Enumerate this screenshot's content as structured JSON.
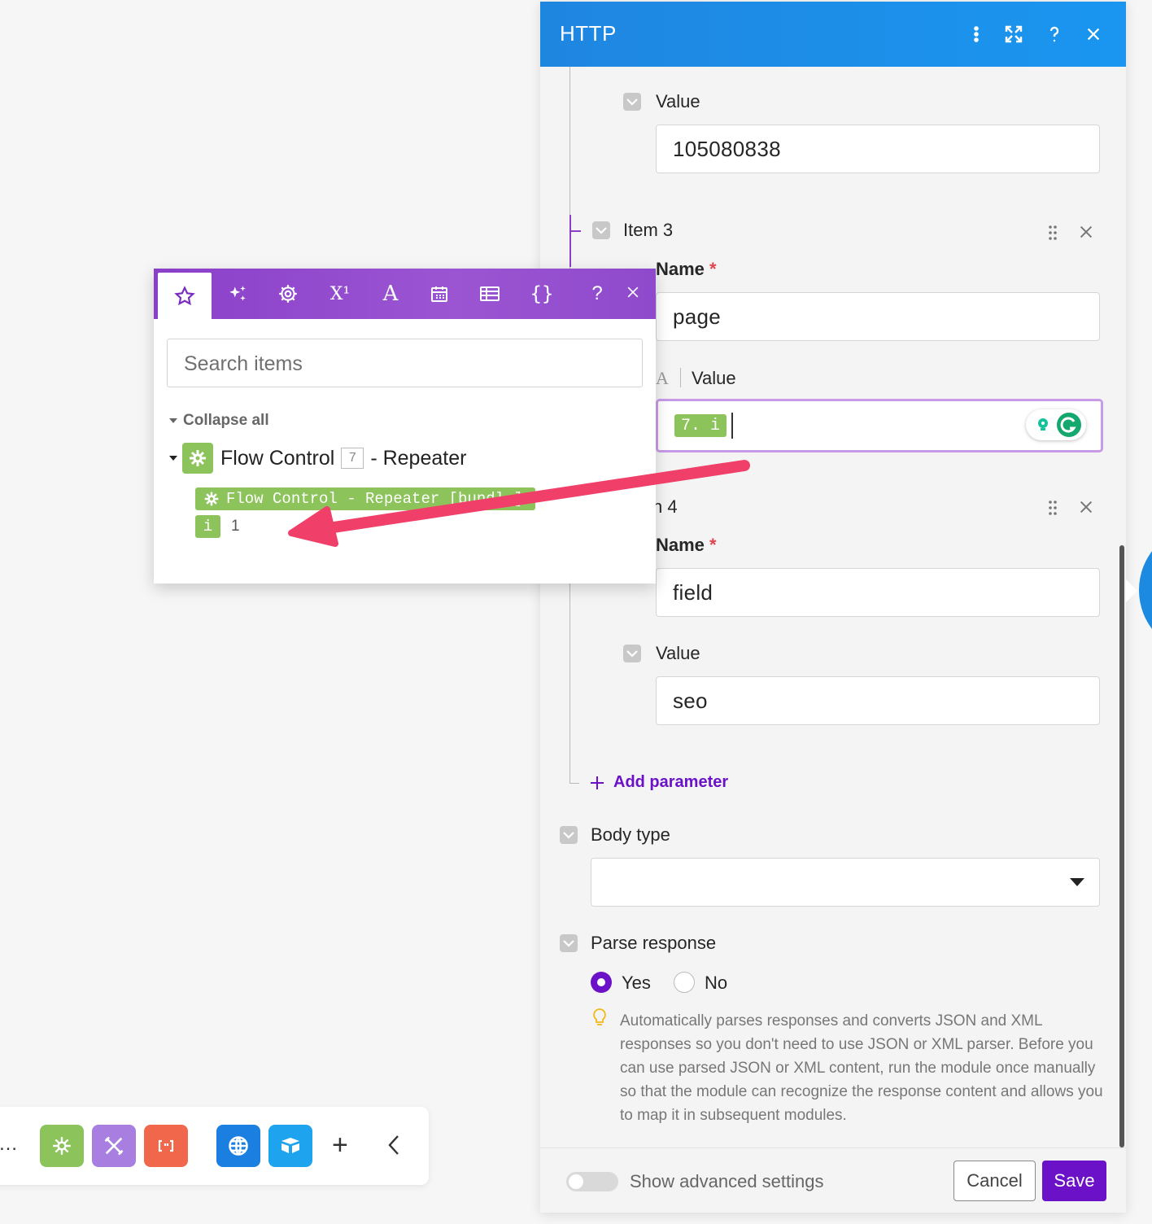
{
  "http_panel": {
    "title": "HTTP",
    "item2_value": {
      "label": "Value",
      "value": "105080838"
    },
    "item3": {
      "label": "Item 3",
      "name_label": "Name",
      "required_mark": "*",
      "name_value": "page",
      "value_prefix": "A",
      "value_label": "Value",
      "value_chip": "7. i"
    },
    "item4": {
      "label": "n 4",
      "name_label": "Name",
      "required_mark": "*",
      "name_value": "field",
      "value_label": "Value",
      "value_value": "seo"
    },
    "add_parameter": "Add parameter",
    "body_type": {
      "label": "Body type",
      "value": ""
    },
    "parse_response": {
      "label": "Parse response",
      "options": [
        "Yes",
        "No"
      ],
      "selected": "Yes",
      "hint": "Automatically parses responses and converts JSON and XML responses so you don't need to use JSON or XML parser. Before you can use parsed JSON or XML content, run the module once manually so that the module can recognize the response content and allows you to map it in subsequent modules."
    },
    "footer": {
      "advanced_label": "Show advanced settings",
      "advanced_on": false,
      "cancel": "Cancel",
      "save": "Save"
    }
  },
  "mapping_panel": {
    "tabs": [
      "favorites",
      "ai",
      "general",
      "math",
      "text",
      "date",
      "array",
      "json"
    ],
    "active_tab": "favorites",
    "help": "?",
    "search_placeholder": "Search items",
    "collapse_all": "Collapse all",
    "module": {
      "name": "Flow Control",
      "number": "7",
      "suffix": "- Repeater",
      "bundle_chip": "Flow Control - Repeater [bundl…]",
      "field_chip": "i",
      "field_value": "1"
    }
  },
  "colors": {
    "http_header": "#1f8ee8",
    "mapping_toolbar": "#9048cc",
    "flow_control_green": "#8cc35a",
    "save_button": "#6b12c8",
    "annotation_arrow": "#f0406a"
  },
  "bottom_toolbar": {
    "more": "…",
    "tools": [
      "flow-control",
      "tools",
      "text-parser",
      "http",
      "airtable"
    ],
    "add": "+",
    "collapse": "<"
  }
}
